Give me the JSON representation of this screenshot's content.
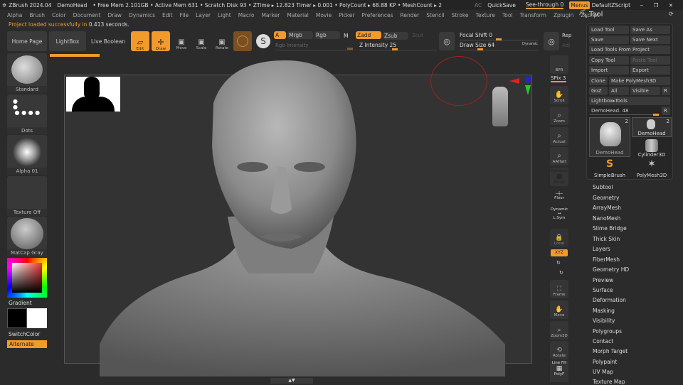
{
  "titlebar": {
    "app": "ZBrush 2024.04",
    "project": "DemoHead",
    "stats": "• Free Mem 2.101GB • Active Mem 631 • Scratch Disk 93 • ZTime ▸ 12.823 Timer ▸ 0.001 • PolyCount ▸ 68.88 KP • MeshCount ▸ 2",
    "ac": "AC",
    "quicksave": "QuickSave",
    "seethrough": "See-through  0",
    "seethrough_value": 0,
    "menus": "Menus",
    "script": "DefaultZScript"
  },
  "menubar": [
    "Alpha",
    "Brush",
    "Color",
    "Document",
    "Draw",
    "Dynamics",
    "Edit",
    "File",
    "Layer",
    "Light",
    "Macro",
    "Marker",
    "Material",
    "Movie",
    "Picker",
    "Preferences",
    "Render",
    "Stencil",
    "Stroke",
    "Texture",
    "Tool",
    "Transform",
    "Zplugin",
    "Zscript"
  ],
  "notice": {
    "text": "Project loaded successfully in ",
    "time": "0.413 seconds."
  },
  "toolbar": {
    "home": "Home Page",
    "lightbox": "LightBox",
    "liveboolean": "Live Boolean",
    "edit": "Edit",
    "draw": "Draw",
    "move": "Move",
    "scale": "Scale",
    "rotate": "Rotate",
    "a": "A",
    "mrgb": "Mrgb",
    "rgb": "Rgb",
    "m": "M",
    "rgb_intensity": "Rgb Intensity",
    "zadd": "Zadd",
    "zsub": "Zsub",
    "zcut": "Zcut",
    "z_intensity": "Z Intensity 25",
    "focal_shift": "Focal Shift 0",
    "draw_size": "Draw Size 64",
    "dynamic": "Dynamic",
    "rep": "Rep",
    "adj": "Adj"
  },
  "left": {
    "brush": "Standard",
    "stroke": "Dots",
    "alpha": "Alpha 01",
    "texture": "Texture Off",
    "material": "MatCap Gray",
    "gradient": "Gradient",
    "switch": "SwitchColor",
    "alternate": "Alternate"
  },
  "rightshelf": {
    "bpr": "BPR",
    "spix": "SPix 3",
    "scroll": "Scroll",
    "zoom": "Zoom",
    "actual": "Actual",
    "aahalf": "AAHalf",
    "dynamic": "Dynamic",
    "persp": "Persp",
    "floor": "Floor",
    "dynamic2": "Dynamic",
    "lsym": "L.Sym",
    "local": "Local",
    "xyz": "XYZ",
    "frame": "Frame",
    "move": "Move",
    "zoom3d": "Zoom3D",
    "rotate": "Rotate",
    "linefill": "Line Fill",
    "polyf": "PolyF"
  },
  "tool": {
    "title": "Tool",
    "load": "Load Tool",
    "saveas": "Save As",
    "save": "Save",
    "savenext": "Save Next",
    "loadproj": "Load Tools From Project",
    "copy": "Copy Tool",
    "paste": "Paste Tool",
    "import": "Import",
    "export": "Export",
    "clone": "Clone",
    "makepoly": "Make PolyMesh3D",
    "goz": "GoZ",
    "all": "All",
    "visible": "Visible",
    "r": "R",
    "lightbox": "Lightbox▸Tools",
    "slider": "DemoHead. 48",
    "thumbs": [
      {
        "name": "DemoHead",
        "count": "2"
      },
      {
        "name": "DemoHead",
        "count": "2"
      },
      {
        "name": "Cylinder3D"
      },
      {
        "name": "SimpleBrush"
      },
      {
        "name": "PolyMesh3D"
      }
    ],
    "subpalettes": [
      "Subtool",
      "Geometry",
      "ArrayMesh",
      "NanoMesh",
      "Slime Bridge",
      "Thick Skin",
      "Layers",
      "FiberMesh",
      "Geometry HD",
      "Preview",
      "Surface",
      "Deformation",
      "Masking",
      "Visibility",
      "Polygroups",
      "Contact",
      "Morph Target",
      "Polypaint",
      "UV Map",
      "Texture Map"
    ]
  },
  "colors": {
    "accent": "#f39a2d",
    "bg": "#2b2b2b"
  }
}
